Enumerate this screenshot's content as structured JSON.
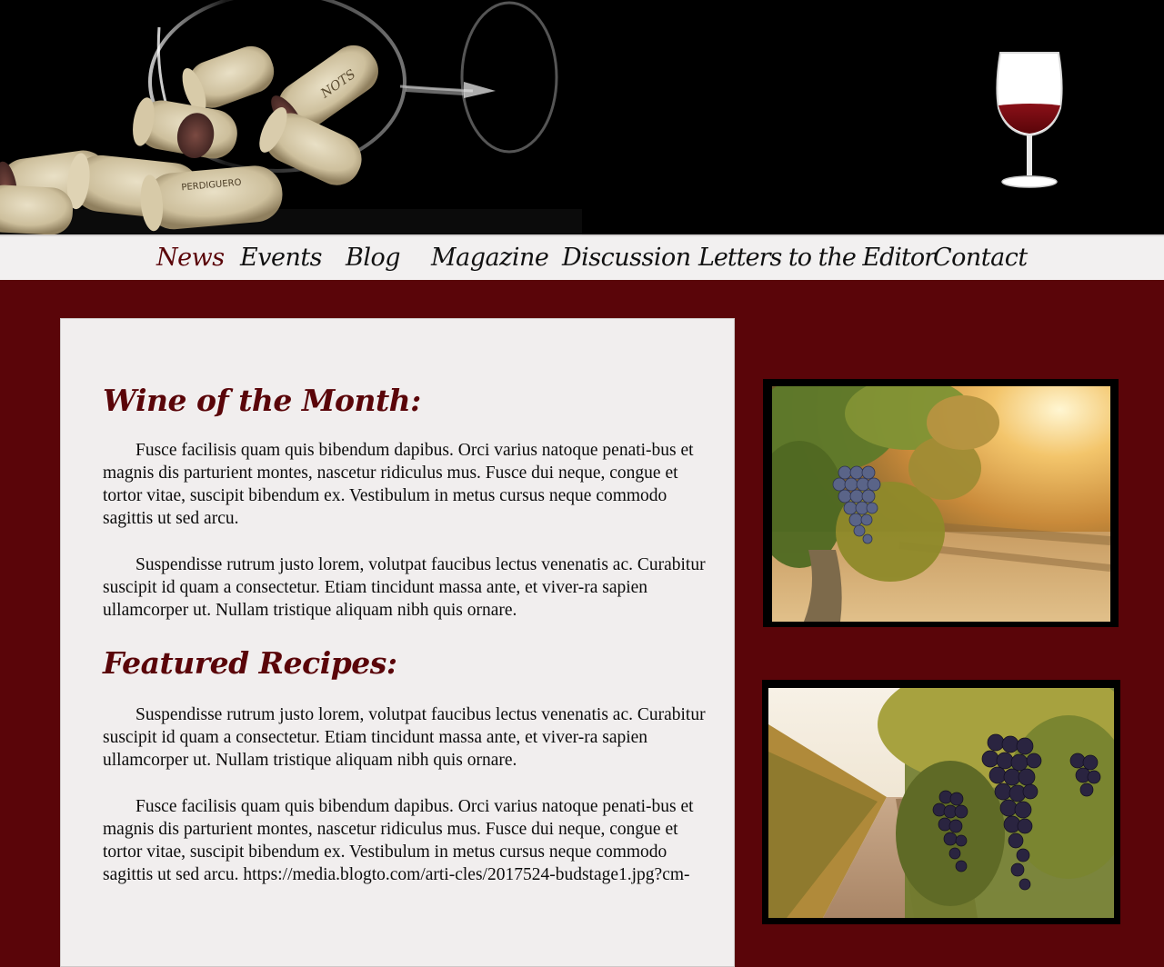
{
  "banner": {
    "cork_image": "corks-spilling-from-wine-glass",
    "logo_icon": "red-wine-glass-icon"
  },
  "nav": {
    "items": [
      {
        "label": "News",
        "active": true
      },
      {
        "label": "Events",
        "active": false
      },
      {
        "label": "Blog",
        "active": false
      },
      {
        "label": "Magazine",
        "active": false
      },
      {
        "label": "Discussion",
        "active": false
      },
      {
        "label": "Letters to the Editor",
        "active": false
      },
      {
        "label": "Contact",
        "active": false
      }
    ]
  },
  "main": {
    "wine_title": "Wine of the Month:",
    "wine_paragraphs": [
      "Fusce facilisis quam quis bibendum dapibus. Orci varius natoque penati-bus et magnis dis parturient montes, nascetur ridiculus mus. Fusce dui neque, congue et tortor vitae, suscipit bibendum ex. Vestibulum in metus cursus neque commodo sagittis ut sed arcu.",
      "Suspendisse rutrum justo lorem, volutpat faucibus lectus venenatis ac. Curabitur suscipit id quam a consectetur. Etiam tincidunt massa ante, et viver-ra sapien ullamcorper ut. Nullam tristique aliquam nibh quis ornare."
    ],
    "recipes_title": "Featured Recipes:",
    "recipe_paragraphs": [
      "Suspendisse rutrum justo lorem, volutpat faucibus lectus venenatis ac. Curabitur suscipit id quam a consectetur. Etiam tincidunt massa ante, et viver-ra sapien ullamcorper ut. Nullam tristique aliquam nibh quis ornare.",
      "Fusce facilisis quam quis bibendum dapibus. Orci varius natoque penati-bus et magnis dis parturient montes, nascetur ridiculus mus. Fusce dui neque, congue et tortor vitae, suscipit bibendum ex. Vestibulum in metus cursus neque commodo sagittis ut sed arcu. https://media.blogto.com/arti-cles/2017524-budstage1.jpg?cm-"
    ]
  },
  "sidebar": {
    "photos": [
      {
        "name": "vineyard-sunlight-grapes-photo"
      },
      {
        "name": "vineyard-rows-grapes-photo"
      }
    ]
  },
  "colors": {
    "brand_burgundy": "#5a0509",
    "card_background": "#f1eeee",
    "nav_background": "#f2f0f0"
  }
}
